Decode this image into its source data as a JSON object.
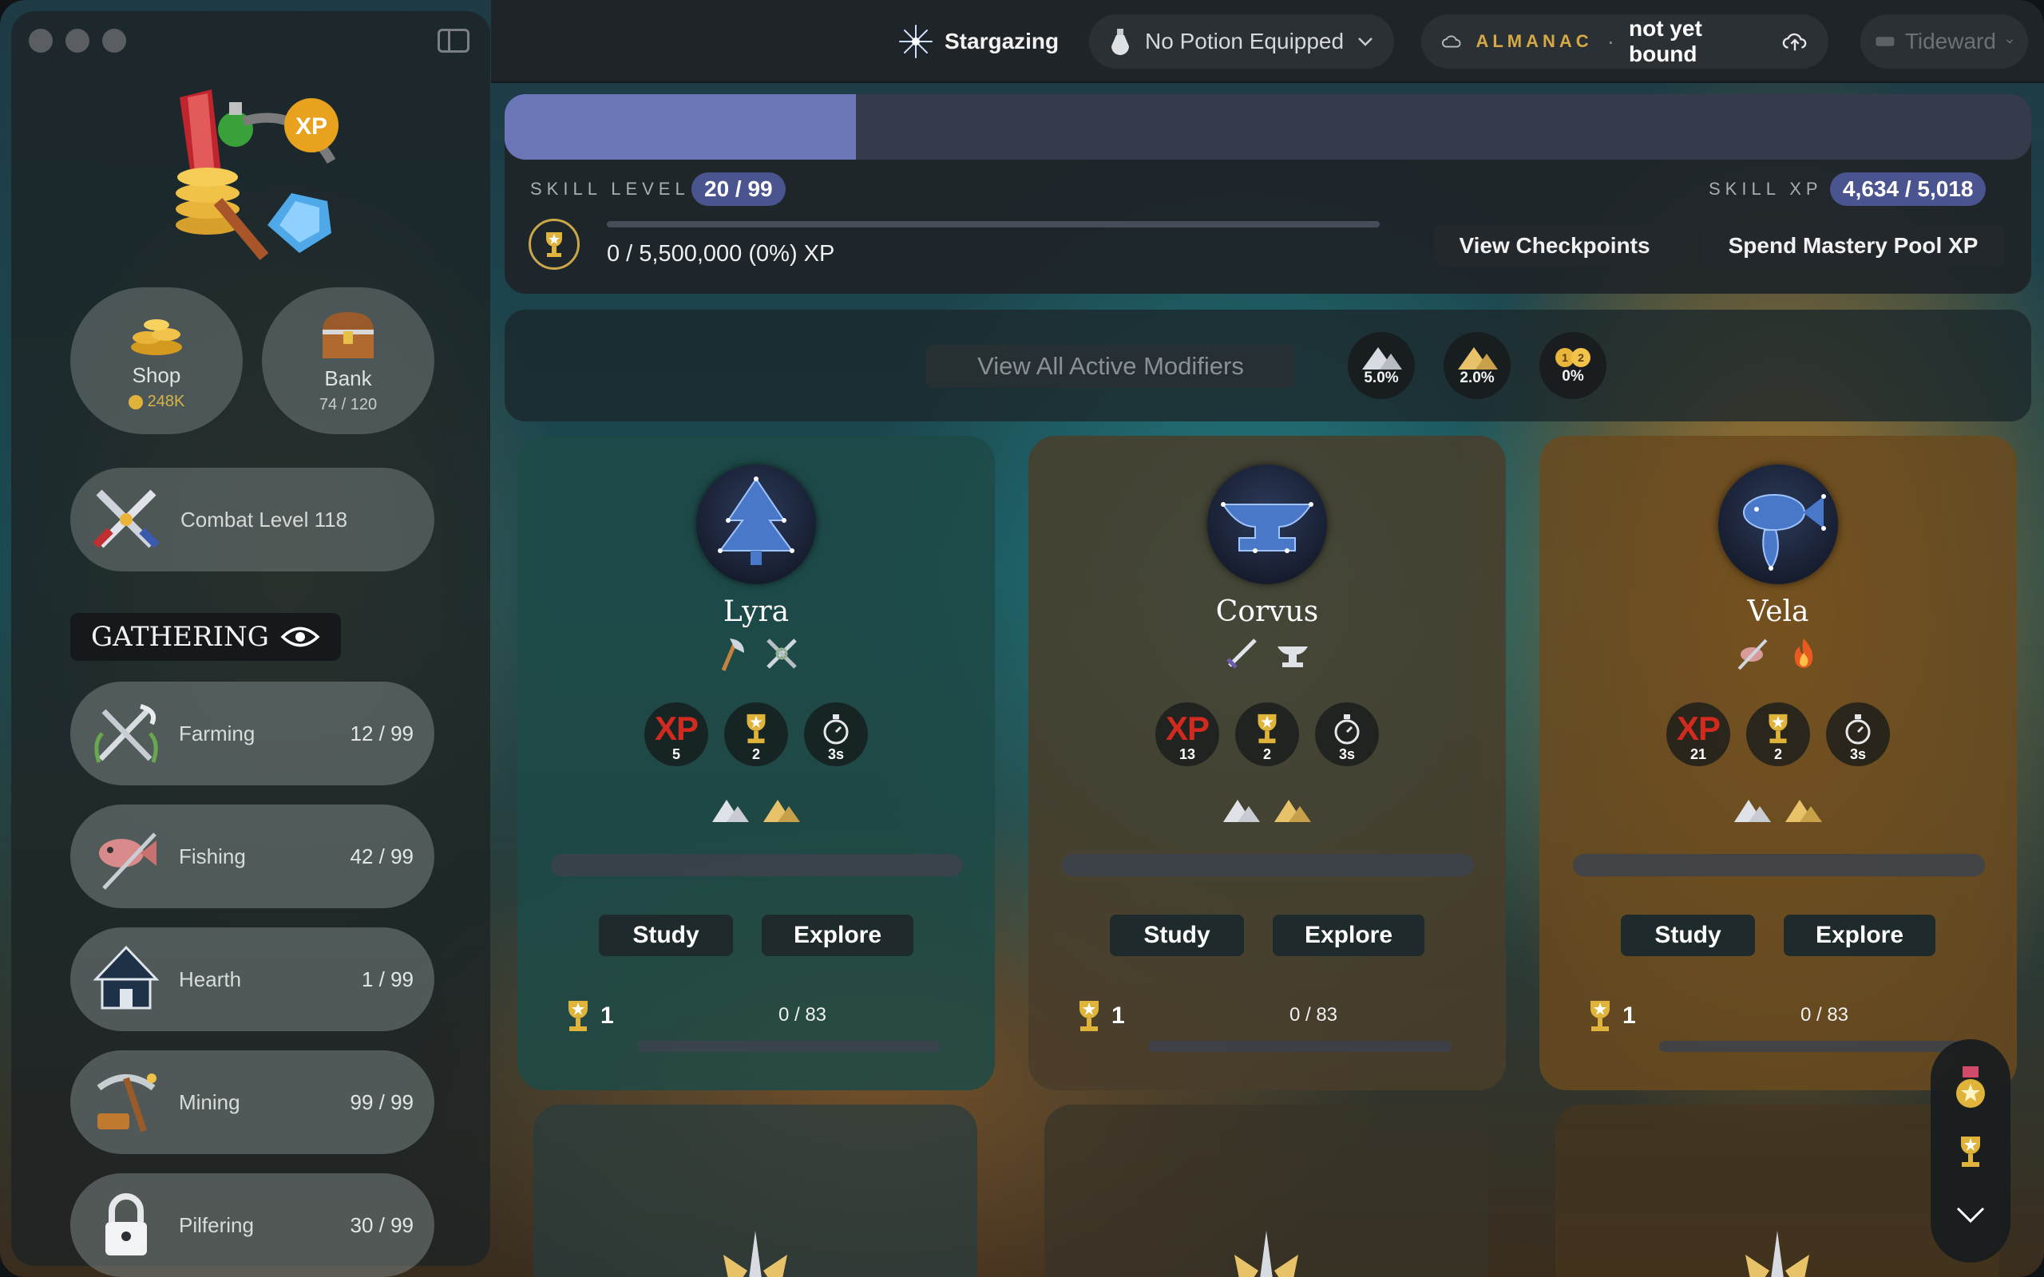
{
  "titlebar": {
    "skill_name": "Stargazing",
    "potion": "No Potion Equipped",
    "almanac_label": "ALMANAC",
    "almanac_separator": "·",
    "almanac_value": "not yet bound",
    "realm": "Tideward"
  },
  "sidebar": {
    "shop": {
      "label": "Shop",
      "sub": "248K"
    },
    "bank": {
      "label": "Bank",
      "sub": "74 / 120"
    },
    "combat": {
      "label": "Combat Level 118"
    },
    "section": {
      "title": "GATHERING"
    },
    "skills": [
      {
        "name": "Farming",
        "level": "12 / 99",
        "icon": "farming-icon"
      },
      {
        "name": "Fishing",
        "level": "42 / 99",
        "icon": "fishing-icon"
      },
      {
        "name": "Hearth",
        "level": "1 / 99",
        "icon": "hearth-icon"
      },
      {
        "name": "Mining",
        "level": "99 / 99",
        "icon": "mining-icon"
      },
      {
        "name": "Pilfering",
        "level": "30 / 99",
        "icon": "pilfering-icon"
      }
    ]
  },
  "skill_header": {
    "level_label": "SKILL LEVEL",
    "level_value": "20 / 99",
    "xp_label": "SKILL XP",
    "xp_value": "4,634 / 5,018",
    "xp_progress_fraction": 0.23,
    "pool_text": "0 / 5,500,000 (0%) XP",
    "pool_progress_fraction": 0,
    "view_checkpoints": "View Checkpoints",
    "spend_pool": "Spend Mastery Pool XP"
  },
  "modifiers": {
    "button": "View All Active Modifiers",
    "chips": [
      {
        "value": "5.0%",
        "icon": "silver-mountain-icon"
      },
      {
        "value": "2.0%",
        "icon": "gold-mountain-icon"
      },
      {
        "value": "0%",
        "icon": "coins-icon"
      }
    ]
  },
  "cards": [
    {
      "name": "Lyra",
      "xp": "5",
      "mastery_gain": "2",
      "interval": "3s",
      "study": "Study",
      "explore": "Explore",
      "mastery_level": "1",
      "mastery_xp": "0 / 83",
      "tint": "#1d4a46",
      "icons": [
        "hatchet-icon",
        "crossed-tools-icon"
      ]
    },
    {
      "name": "Corvus",
      "xp": "13",
      "mastery_gain": "2",
      "interval": "3s",
      "study": "Study",
      "explore": "Explore",
      "mastery_level": "1",
      "mastery_xp": "0 / 83",
      "tint": "#4a3d2a",
      "icons": [
        "sword-icon",
        "anvil-icon"
      ]
    },
    {
      "name": "Vela",
      "xp": "21",
      "mastery_gain": "2",
      "interval": "3s",
      "study": "Study",
      "explore": "Explore",
      "mastery_level": "1",
      "mastery_xp": "0 / 83",
      "tint": "#6a4a1e",
      "icons": [
        "fishing-rod-icon",
        "fire-icon"
      ]
    }
  ]
}
